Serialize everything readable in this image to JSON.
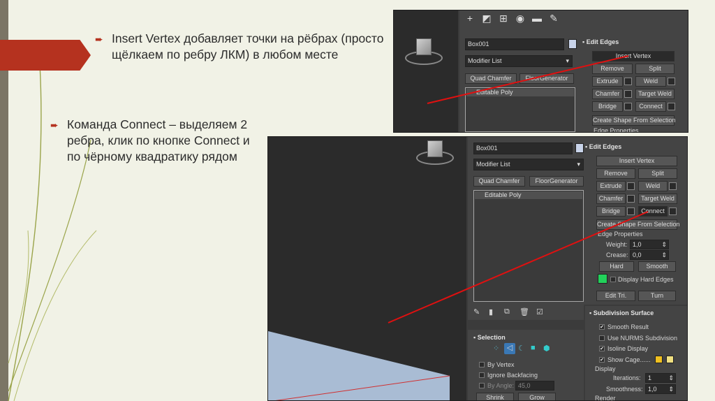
{
  "slide": {
    "bullet1": "Insert Vertex добавляет точки на рёбрах (просто щёлкаем по ребру ЛКМ) в любом месте",
    "bullet2": "Команда Connect – выделяем 2 ребра, клик по кнопке Connect и по чёрному квадратику рядом",
    "accent_color": "#b5321f"
  },
  "shot1": {
    "object_name": "Box001",
    "modifier_list": "Modifier List",
    "quad_chamfer": "Quad Chamfer",
    "floor_generator": "FloorGenerator",
    "stack_item": "Editable Poly",
    "section": "Edit Edges",
    "insert_vertex": "Insert Vertex",
    "remove": "Remove",
    "split": "Split",
    "extrude": "Extrude",
    "weld": "Weld",
    "chamfer": "Chamfer",
    "target_weld": "Target Weld",
    "bridge": "Bridge",
    "connect": "Connect",
    "create_shape": "Create Shape From Selection",
    "edge_properties": "Edge Properties"
  },
  "shot2": {
    "object_name": "Box001",
    "modifier_list": "Modifier List",
    "quad_chamfer": "Quad Chamfer",
    "floor_generator": "FloorGenerator",
    "stack_item": "Editable Poly",
    "section": "Edit Edges",
    "insert_vertex": "Insert Vertex",
    "remove": "Remove",
    "split": "Split",
    "extrude": "Extrude",
    "weld": "Weld",
    "chamfer": "Chamfer",
    "target_weld": "Target Weld",
    "bridge": "Bridge",
    "connect": "Connect",
    "create_shape": "Create Shape From Selection",
    "edge_properties": "Edge Properties",
    "weight_label": "Weight:",
    "weight_value": "1,0",
    "crease_label": "Crease:",
    "crease_value": "0,0",
    "hard": "Hard",
    "smooth": "Smooth",
    "display_hard_edges": "Display Hard Edges",
    "edit_tri": "Edit Tri.",
    "turn": "Turn",
    "selection_title": "Selection",
    "by_vertex": "By Vertex",
    "ignore_backfacing": "Ignore Backfacing",
    "by_angle": "By Angle:",
    "by_angle_value": "45,0",
    "shrink": "Shrink",
    "grow": "Grow",
    "subdivision_title": "Subdivision Surface",
    "smooth_result": "Smooth Result",
    "use_nurms": "Use NURMS Subdivision",
    "isoline_display": "Isoline Display",
    "show_cage": "Show Cage......",
    "display": "Display",
    "iterations_label": "Iterations:",
    "iterations_value": "1",
    "smoothness_label": "Smoothness:",
    "smoothness_value": "1,0",
    "render": "Render",
    "hard_edge_color": "#22d15a",
    "cage_colors": [
      "#f0c020",
      "#f0e080"
    ]
  }
}
